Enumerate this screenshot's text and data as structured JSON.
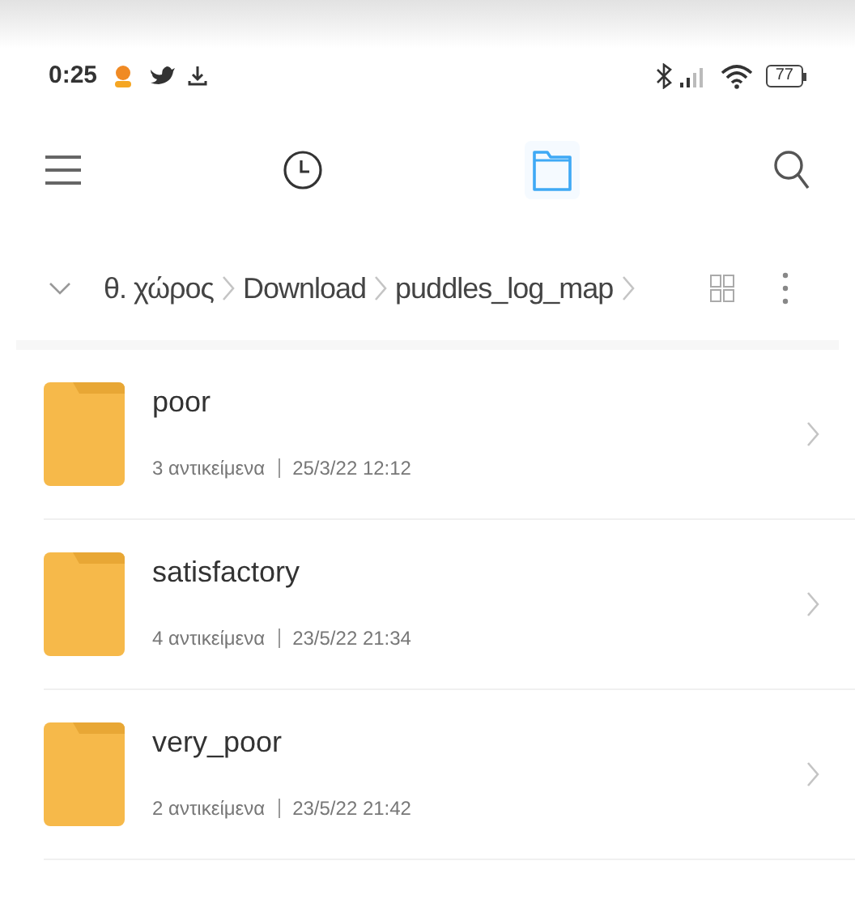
{
  "status_bar": {
    "time": "0:25",
    "battery": "77"
  },
  "toolbar": {
    "tabs": [
      {
        "kind": "recent",
        "selected": false
      },
      {
        "kind": "files",
        "selected": true
      }
    ]
  },
  "breadcrumb": {
    "segments": [
      "θ. χώρος",
      "Download",
      "puddles_log_map"
    ]
  },
  "folders": [
    {
      "name": "poor",
      "count": "3 αντικείμενα",
      "date": "25/3/22 12:12"
    },
    {
      "name": "satisfactory",
      "count": "4 αντικείμενα",
      "date": "23/5/22 21:34"
    },
    {
      "name": "very_poor",
      "count": "2 αντικείμενα",
      "date": "23/5/22 21:42"
    }
  ]
}
